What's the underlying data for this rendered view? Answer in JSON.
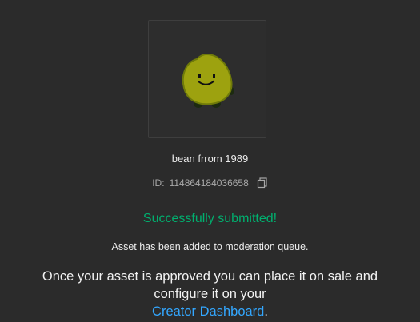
{
  "asset": {
    "name": "bean frrom 1989",
    "id_label": "ID:",
    "id_value": "114864184036658",
    "thumbnail_icon": "bean-character-icon"
  },
  "status": {
    "success_text": "Successfully submitted!",
    "success_color": "#00b06f",
    "moderation_text": "Asset has been added to moderation queue."
  },
  "approval": {
    "text_before": "Once your asset is approved you can place it on sale and configure it on your",
    "link_text": "Creator Dashboard",
    "text_after": ".",
    "link_color": "#33a7ff"
  },
  "icons": {
    "copy": "copy-icon"
  }
}
